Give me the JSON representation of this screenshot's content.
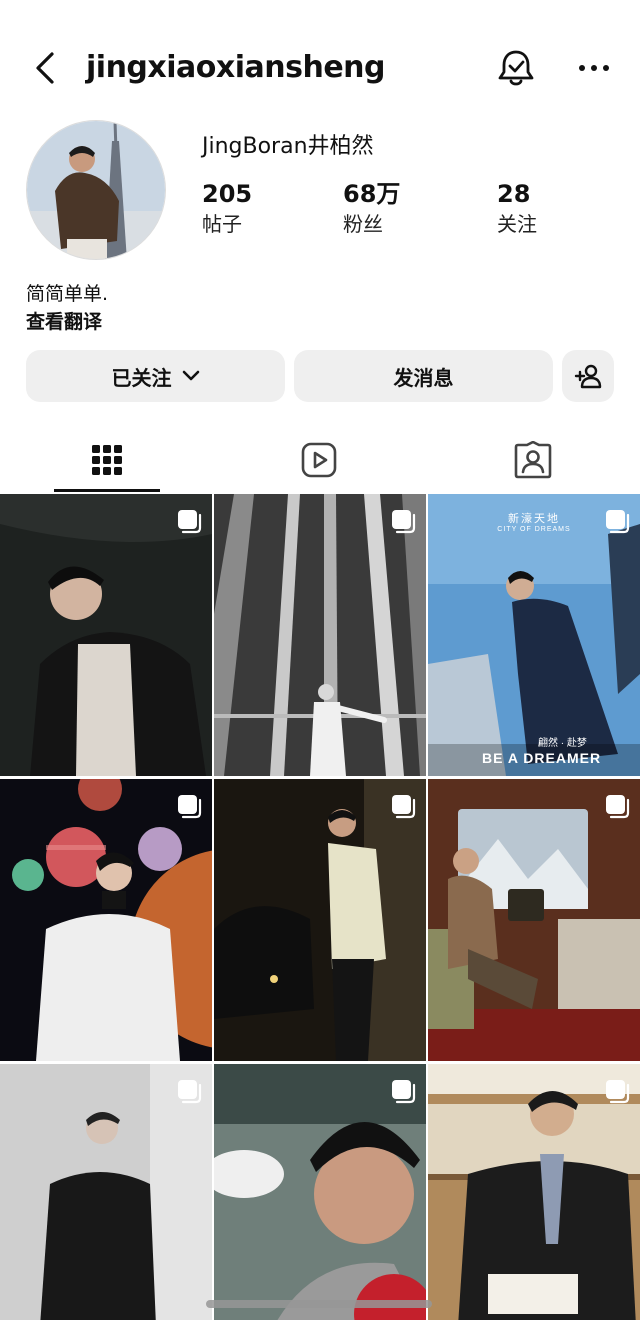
{
  "header": {
    "username": "jingxiaoxiansheng"
  },
  "profile": {
    "display_name": "JingBoran井柏然",
    "stats": [
      {
        "value": "205",
        "label": "帖子"
      },
      {
        "value": "68万",
        "label": "粉丝"
      },
      {
        "value": "28",
        "label": "关注"
      }
    ],
    "bio": "简简单单.",
    "translate_label": "查看翻译"
  },
  "actions": {
    "following_label": "已关注",
    "message_label": "发消息"
  },
  "posts": {
    "p3": {
      "brand_cn": "新濠天地",
      "brand_en": "CITY OF DREAMS",
      "slogan_cn": "翩然 · 赴梦",
      "slogan_en": "BE A DREAMER"
    }
  },
  "colors": {
    "button_bg": "#efefef",
    "text": "#111111"
  }
}
